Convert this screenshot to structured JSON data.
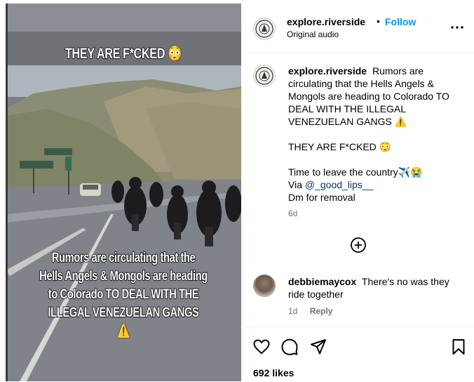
{
  "media": {
    "overlay_top": "THEY ARE F*CKED",
    "overlay_top_emoji": "😳",
    "overlay_bottom_lines": [
      "Rumors are circulating that the",
      "Hells Angels & Mongols are heading",
      "to Colorado TO DEAL WITH THE",
      "ILLEGAL VENEZUELAN GANGS"
    ],
    "overlay_bottom_emoji": "⚠️"
  },
  "header": {
    "username": "explore.riverside",
    "separator": "•",
    "follow_label": "Follow",
    "audio": "Original audio",
    "more_label": "•••"
  },
  "caption": {
    "username": "explore.riverside",
    "text_line1": "Rumors are circulating that the Hells Angels & Mongols are heading to Colorado TO DEAL WITH THE ILLEGAL VENEZUELAN GANGS ⚠️",
    "text_line2": "THEY ARE F*CKED 😳",
    "text_line3": "Time to leave the country✈️😭",
    "via_prefix": "Via ",
    "via_mention": "@_good_lips__",
    "text_line5": "Dm for removal",
    "time": "6d"
  },
  "comment": {
    "username": "debbiemaycox",
    "text": "There's no was they ride together",
    "time": "1d",
    "reply_label": "Reply"
  },
  "actions": {
    "likes": "692 likes"
  },
  "colors": {
    "accent": "#0095f6",
    "mention": "#00376b",
    "secondary_text": "#737373",
    "divider": "#efefef"
  },
  "icons": [
    "like-icon",
    "comment-icon",
    "share-icon",
    "save-icon",
    "add-comment-icon",
    "more-options-icon"
  ]
}
